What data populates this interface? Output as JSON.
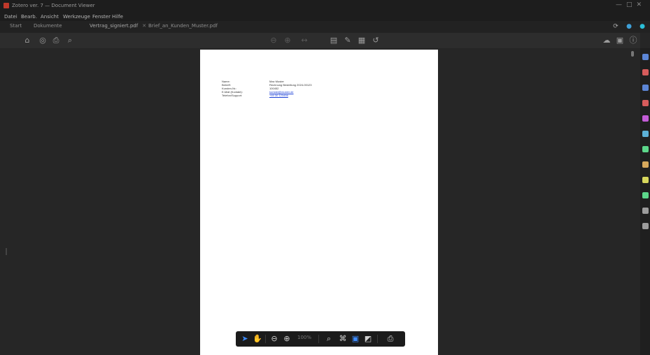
{
  "window": {
    "title": "Zotero ver. 7 — Document Viewer"
  },
  "menu": {
    "items": [
      "Datei",
      "Bearb.",
      "Ansicht",
      "Werkzeuge",
      "Fenster",
      "Hilfe"
    ]
  },
  "tabs": [
    {
      "label": "Start",
      "active": false
    },
    {
      "label": "Dokumente",
      "active": false
    },
    {
      "label": "Vertrag_signiert.pdf",
      "active": true
    },
    {
      "label": "Brief_an_Kunden_Muster.pdf",
      "active": false
    }
  ],
  "document": {
    "fields": [
      {
        "label": "Name:",
        "value": "Max Muster"
      },
      {
        "label": "Betreff:",
        "value": "Rechnung Bestellung 2024-00123"
      },
      {
        "label": "Kunden-Nr.:",
        "value": "100452"
      },
      {
        "label": "E-Mail (Kontakt):",
        "value": "kontakt@muster.de",
        "link": true
      },
      {
        "label": "Telefon/Support:",
        "value": "+49 30 123456",
        "link": true
      }
    ]
  },
  "float_toolbar": {
    "zoom": "100%"
  },
  "icons": {
    "toolbar": [
      "sidebar-icon",
      "search-icon",
      "print-icon",
      "zoom-icon"
    ],
    "annotation": [
      "highlight-icon",
      "note-icon",
      "text-icon",
      "draw-icon",
      "pen-icon",
      "eraser-icon",
      "undo-icon"
    ],
    "right_sidebar_colors": [
      "#5c86d6",
      "#d65c5c",
      "#5cb0d6",
      "#c25cd6",
      "#5cd68a",
      "#d6a85c",
      "#d6d65c",
      "#9c9c9c"
    ]
  }
}
